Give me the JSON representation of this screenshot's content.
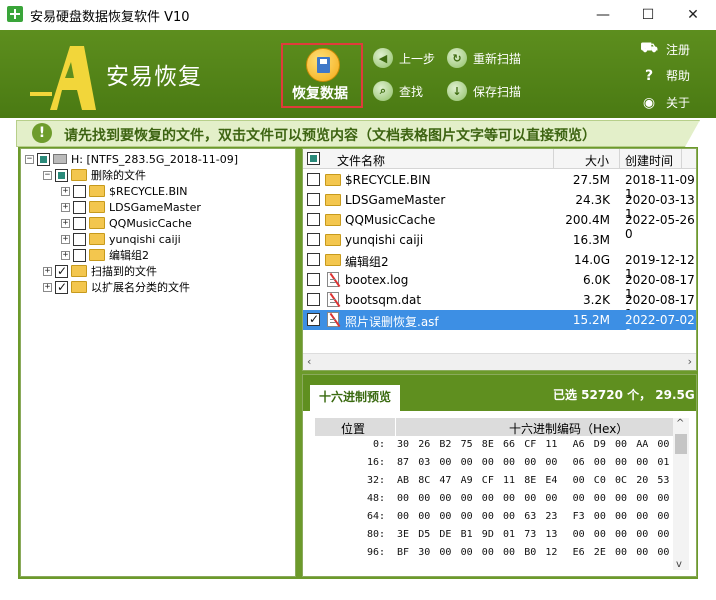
{
  "window": {
    "title": "安易硬盘数据恢复软件 V10",
    "minimize": "—",
    "maximize": "☐",
    "close": "✕"
  },
  "header": {
    "logo_text": "安易恢复",
    "recover_label": "恢复数据",
    "toolbar": {
      "prev_step": "上一步",
      "rescan": "重新扫描",
      "find": "查找",
      "save_scan": "保存扫描"
    },
    "side": {
      "register": "注册",
      "help": "帮助",
      "about": "关于"
    }
  },
  "hint": {
    "icon": "!",
    "text": "请先找到要恢复的文件，双击文件可以预览内容（文档表格图片文字等可以直接预览）"
  },
  "tree": {
    "root": "H: [NTFS_283.5G_2018-11-09]",
    "deleted": "删除的文件",
    "children": [
      "$RECYCLE.BIN",
      "LDSGameMaster",
      "QQMusicCache",
      "yunqishi caiji",
      "编辑组2"
    ],
    "scanned": "扫描到的文件",
    "by_ext": "以扩展名分类的文件"
  },
  "list": {
    "headers": {
      "name": "文件名称",
      "size": "大小",
      "created": "创建时间"
    },
    "rows": [
      {
        "name": "$RECYCLE.BIN",
        "size": "27.5M",
        "date": "2018-11-09 1",
        "type": "folder",
        "checked": false
      },
      {
        "name": "LDSGameMaster",
        "size": "24.3K",
        "date": "2020-03-13 1",
        "type": "folder",
        "checked": false
      },
      {
        "name": "QQMusicCache",
        "size": "200.4M",
        "date": "2022-05-26 0",
        "type": "folder",
        "checked": false
      },
      {
        "name": "yunqishi caiji",
        "size": "16.3M",
        "date": "",
        "type": "folder",
        "checked": false
      },
      {
        "name": "编辑组2",
        "size": "14.0G",
        "date": "2019-12-12 1",
        "type": "folder",
        "checked": false
      },
      {
        "name": "bootex.log",
        "size": "6.0K",
        "date": "2020-08-17 1",
        "type": "doc-bad",
        "checked": false
      },
      {
        "name": "bootsqm.dat",
        "size": "3.2K",
        "date": "2020-08-17 1",
        "type": "doc-bad",
        "checked": false
      },
      {
        "name": "照片误删恢复.asf",
        "size": "15.2M",
        "date": "2022-07-02 1",
        "type": "doc-bad",
        "checked": true
      }
    ]
  },
  "hex": {
    "tab": "十六进制预览",
    "summary": "已选 52720 个， 29.5G",
    "col_offset": "位置",
    "col_hex": "十六进制编码（Hex）",
    "rows": [
      {
        "off": "0:",
        "bytes": [
          "30",
          "26",
          "B2",
          "75",
          "8E",
          "66",
          "CF",
          "11",
          "A6",
          "D9",
          "00",
          "AA",
          "00"
        ]
      },
      {
        "off": "16:",
        "bytes": [
          "87",
          "03",
          "00",
          "00",
          "00",
          "00",
          "00",
          "00",
          "06",
          "00",
          "00",
          "00",
          "01"
        ]
      },
      {
        "off": "32:",
        "bytes": [
          "AB",
          "8C",
          "47",
          "A9",
          "CF",
          "11",
          "8E",
          "E4",
          "00",
          "C0",
          "0C",
          "20",
          "53"
        ]
      },
      {
        "off": "48:",
        "bytes": [
          "00",
          "00",
          "00",
          "00",
          "00",
          "00",
          "00",
          "00",
          "00",
          "00",
          "00",
          "00",
          "00"
        ]
      },
      {
        "off": "64:",
        "bytes": [
          "00",
          "00",
          "00",
          "00",
          "00",
          "00",
          "63",
          "23",
          "F3",
          "00",
          "00",
          "00",
          "00"
        ]
      },
      {
        "off": "80:",
        "bytes": [
          "3E",
          "D5",
          "DE",
          "B1",
          "9D",
          "01",
          "73",
          "13",
          "00",
          "00",
          "00",
          "00",
          "00"
        ]
      },
      {
        "off": "96:",
        "bytes": [
          "BF",
          "30",
          "00",
          "00",
          "00",
          "00",
          "B0",
          "12",
          "E6",
          "2E",
          "00",
          "00",
          "00"
        ]
      }
    ]
  }
}
